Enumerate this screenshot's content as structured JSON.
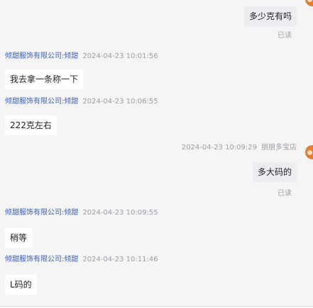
{
  "messages": [
    {
      "text": "多少克有吗",
      "read": "已读"
    },
    {
      "sender": "倾甜服饰有限公司:倾甜",
      "time": "2024-04-23 10:01:56",
      "text": "我去拿一条称一下"
    },
    {
      "sender": "倾甜服饰有限公司:倾甜",
      "time": "2024-04-23 10:06:55",
      "text": "222克左右"
    },
    {
      "time": "2024-04-23 10:09:29",
      "shop": "朋朋多宝店",
      "text": "多大码的",
      "read": "已读"
    },
    {
      "sender": "倾甜服饰有限公司:倾甜",
      "time": "2024-04-23 10:09:55",
      "text": "稍等"
    },
    {
      "sender": "倾甜服饰有限公司:倾甜",
      "time": "2024-04-23 10:11:46",
      "text": "L码的"
    }
  ],
  "colors": {
    "sender": "#3c5fb5",
    "meta": "#9aa0a6",
    "avatar": "#f07a2c"
  },
  "icons": {
    "avatar": "avatar-icon"
  }
}
